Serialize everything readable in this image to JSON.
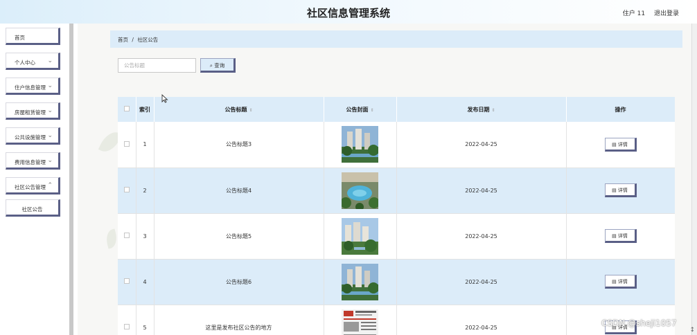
{
  "app": {
    "title": "社区信息管理系统"
  },
  "user": {
    "name": "住户 11",
    "logout": "退出登录"
  },
  "sidebar": {
    "items": [
      {
        "label": "首页"
      },
      {
        "label": "个人中心"
      },
      {
        "label": "住户信息管理"
      },
      {
        "label": "房屋租赁管理"
      },
      {
        "label": "公共设施管理"
      },
      {
        "label": "费用信息管理"
      },
      {
        "label": "社区公告管理"
      },
      {
        "label": "社区公告"
      }
    ]
  },
  "breadcrumb": {
    "home": "首页",
    "sep": "/",
    "current": "社区公告"
  },
  "search": {
    "placeholder": "公告标题",
    "button": "查询"
  },
  "table": {
    "headers": {
      "index": "索引",
      "title": "公告标题",
      "cover": "公告封面",
      "date": "发布日期",
      "actions": "操作"
    },
    "detail_label": "详情",
    "rows": [
      {
        "index": "1",
        "title": "公告标题3",
        "date": "2022-04-25"
      },
      {
        "index": "2",
        "title": "公告标题4",
        "date": "2022-04-25"
      },
      {
        "index": "3",
        "title": "公告标题5",
        "date": "2022-04-25"
      },
      {
        "index": "4",
        "title": "公告标题6",
        "date": "2022-04-25"
      },
      {
        "index": "5",
        "title": "这里是发布社区公告的地方",
        "date": "2022-04-25"
      }
    ]
  },
  "watermark": "CSDN @sheji1057",
  "colors": {
    "accent": "#dcecf9",
    "button_shadow": "#5a5f86"
  }
}
